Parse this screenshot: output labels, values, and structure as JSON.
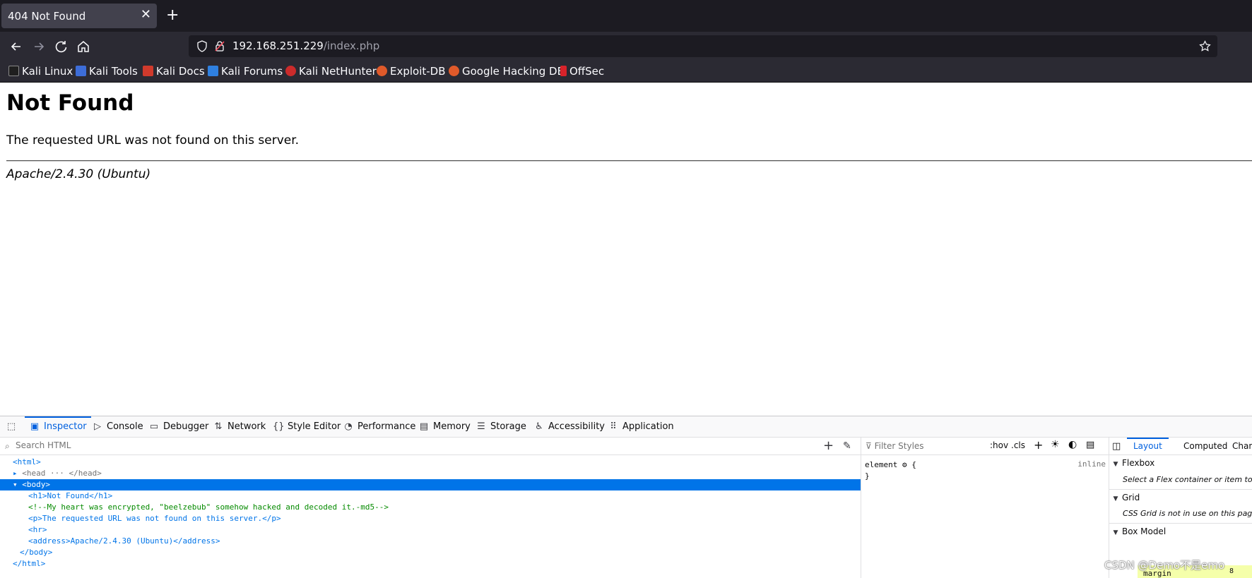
{
  "browser": {
    "tab": {
      "title": "404 Not Found",
      "close": "✕"
    },
    "new_tab": "+",
    "url": {
      "host": "192.168.251.229",
      "path": "/index.php"
    },
    "bookmarks": [
      {
        "label": "Kali Linux",
        "color": "#1f1f1f"
      },
      {
        "label": "Kali Tools",
        "color": "#3d6dd8"
      },
      {
        "label": "Kali Docs",
        "color": "#d03a2c"
      },
      {
        "label": "Kali Forums",
        "color": "#2f80e0"
      },
      {
        "label": "Kali NetHunter",
        "color": "#cc2b2b"
      },
      {
        "label": "Exploit-DB",
        "color": "#e05a2a"
      },
      {
        "label": "Google Hacking DB",
        "color": "#e05a2a"
      },
      {
        "label": "OffSec",
        "color": "#d8232a"
      }
    ]
  },
  "page": {
    "heading": "Not Found",
    "message": "The requested URL was not found on this server.",
    "address": "Apache/2.4.30 (Ubuntu)"
  },
  "devtools": {
    "tabs": [
      "Inspector",
      "Console",
      "Debugger",
      "Network",
      "Style Editor",
      "Performance",
      "Memory",
      "Storage",
      "Accessibility",
      "Application"
    ],
    "search_placeholder": "Search HTML",
    "markup": {
      "html_open": "<html>",
      "head_line": "<head",
      "head_close": "</head>",
      "body_open": "<body>",
      "h1_line": "<h1>Not Found</h1>",
      "comment": "<!--My heart was encrypted, \"beelzebub\" somehow hacked and decoded it.-md5-->",
      "p_line": "<p>The requested URL was not found on this server.</p>",
      "hr_line": "<hr>",
      "address_line": "<address>Apache/2.4.30 (Ubuntu)</address>",
      "body_close": "</body>",
      "html_close": "</html>"
    },
    "rules": {
      "filter_placeholder": "Filter Styles",
      "hov": ":hov",
      "cls": ".cls",
      "selector": "element",
      "open_brace": "{",
      "close_brace": "}",
      "origin": "inline"
    },
    "layout": {
      "tabs": [
        "Layout",
        "Computed",
        "Chan"
      ],
      "sections": [
        {
          "title": "Flexbox",
          "message": "Select a Flex container or item to c"
        },
        {
          "title": "Grid",
          "message": "CSS Grid is not in use on this page"
        },
        {
          "title": "Box Model",
          "message": ""
        }
      ],
      "margin_label": "margin",
      "margin_value": "8"
    }
  },
  "watermark": "CSDN @Demo不是emo"
}
